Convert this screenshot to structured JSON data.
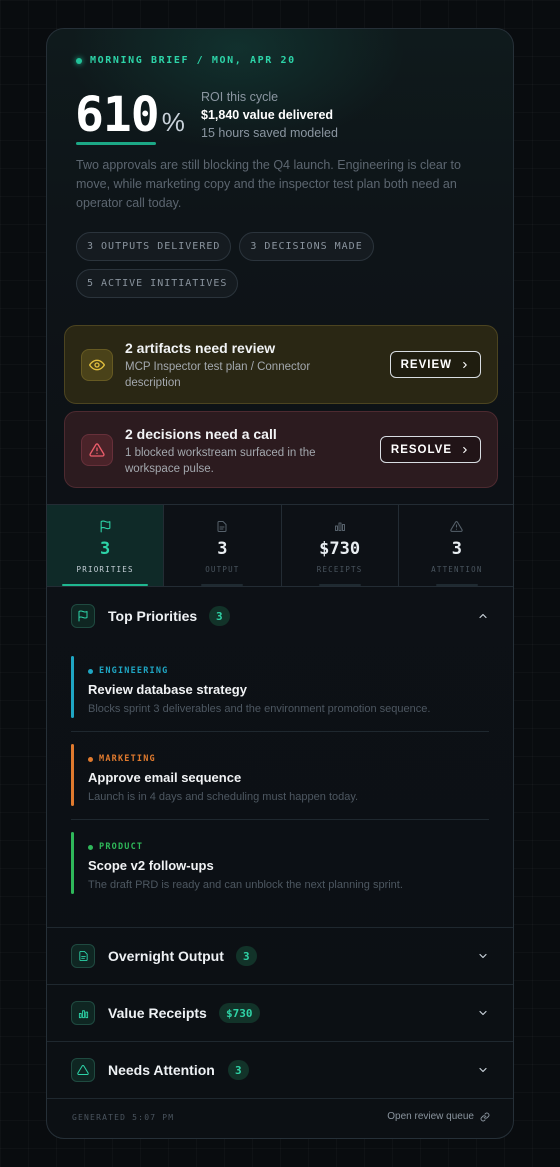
{
  "header": {
    "brief_label": "MORNING BRIEF / MON, APR 20",
    "roi_value": "610",
    "roi_unit": "%",
    "roi_caption": "ROI this cycle",
    "value_delivered": "$1,840 value delivered",
    "hours_saved": "15 hours saved modeled",
    "summary": "Two approvals are still blocking the Q4 launch. Engineering is clear to move, while marketing copy and the inspector test plan both need an operator call today."
  },
  "chips": [
    "3 OUTPUTS DELIVERED",
    "3 DECISIONS MADE",
    "5 ACTIVE INITIATIVES"
  ],
  "alerts": {
    "review": {
      "title": "2 artifacts need review",
      "subtitle": "MCP Inspector test plan / Connector description",
      "button": "REVIEW",
      "icon": "eye-icon",
      "accent": "#d9b83a"
    },
    "resolve": {
      "title": "2 decisions need a call",
      "subtitle": "1 blocked workstream surfaced in the workspace pulse.",
      "button": "RESOLVE",
      "icon": "warning-icon",
      "accent": "#e05a66"
    }
  },
  "tabs": [
    {
      "value": "3",
      "label": "PRIORITIES",
      "icon": "flag-icon",
      "active": true
    },
    {
      "value": "3",
      "label": "OUTPUT",
      "icon": "document-icon",
      "active": false
    },
    {
      "value": "$730",
      "label": "RECEIPTS",
      "icon": "bar-chart-icon",
      "active": false
    },
    {
      "value": "3",
      "label": "ATTENTION",
      "icon": "warning-icon",
      "active": false
    }
  ],
  "priorities": {
    "title": "Top Priorities",
    "count": "3",
    "items": [
      {
        "tag": "ENGINEERING",
        "title": "Review database strategy",
        "subtitle": "Blocks sprint 3 deliverables and the environment promotion sequence.",
        "color": "#1fa6c4"
      },
      {
        "tag": "MARKETING",
        "title": "Approve email sequence",
        "subtitle": "Launch is in 4 days and scheduling must happen today.",
        "color": "#e07a2e"
      },
      {
        "tag": "PRODUCT",
        "title": "Scope v2 follow-ups",
        "subtitle": "The draft PRD is ready and can unblock the next planning sprint.",
        "color": "#2fb85a"
      }
    ]
  },
  "sections": {
    "output": {
      "title": "Overnight Output",
      "badge": "3"
    },
    "receipts": {
      "title": "Value Receipts",
      "badge": "$730"
    },
    "attention": {
      "title": "Needs Attention",
      "badge": "3"
    }
  },
  "footer": {
    "generated": "GENERATED 5:07 PM",
    "link": "Open review queue"
  },
  "colors": {
    "accent": "#2dd4a8",
    "background": "#090c0f"
  }
}
